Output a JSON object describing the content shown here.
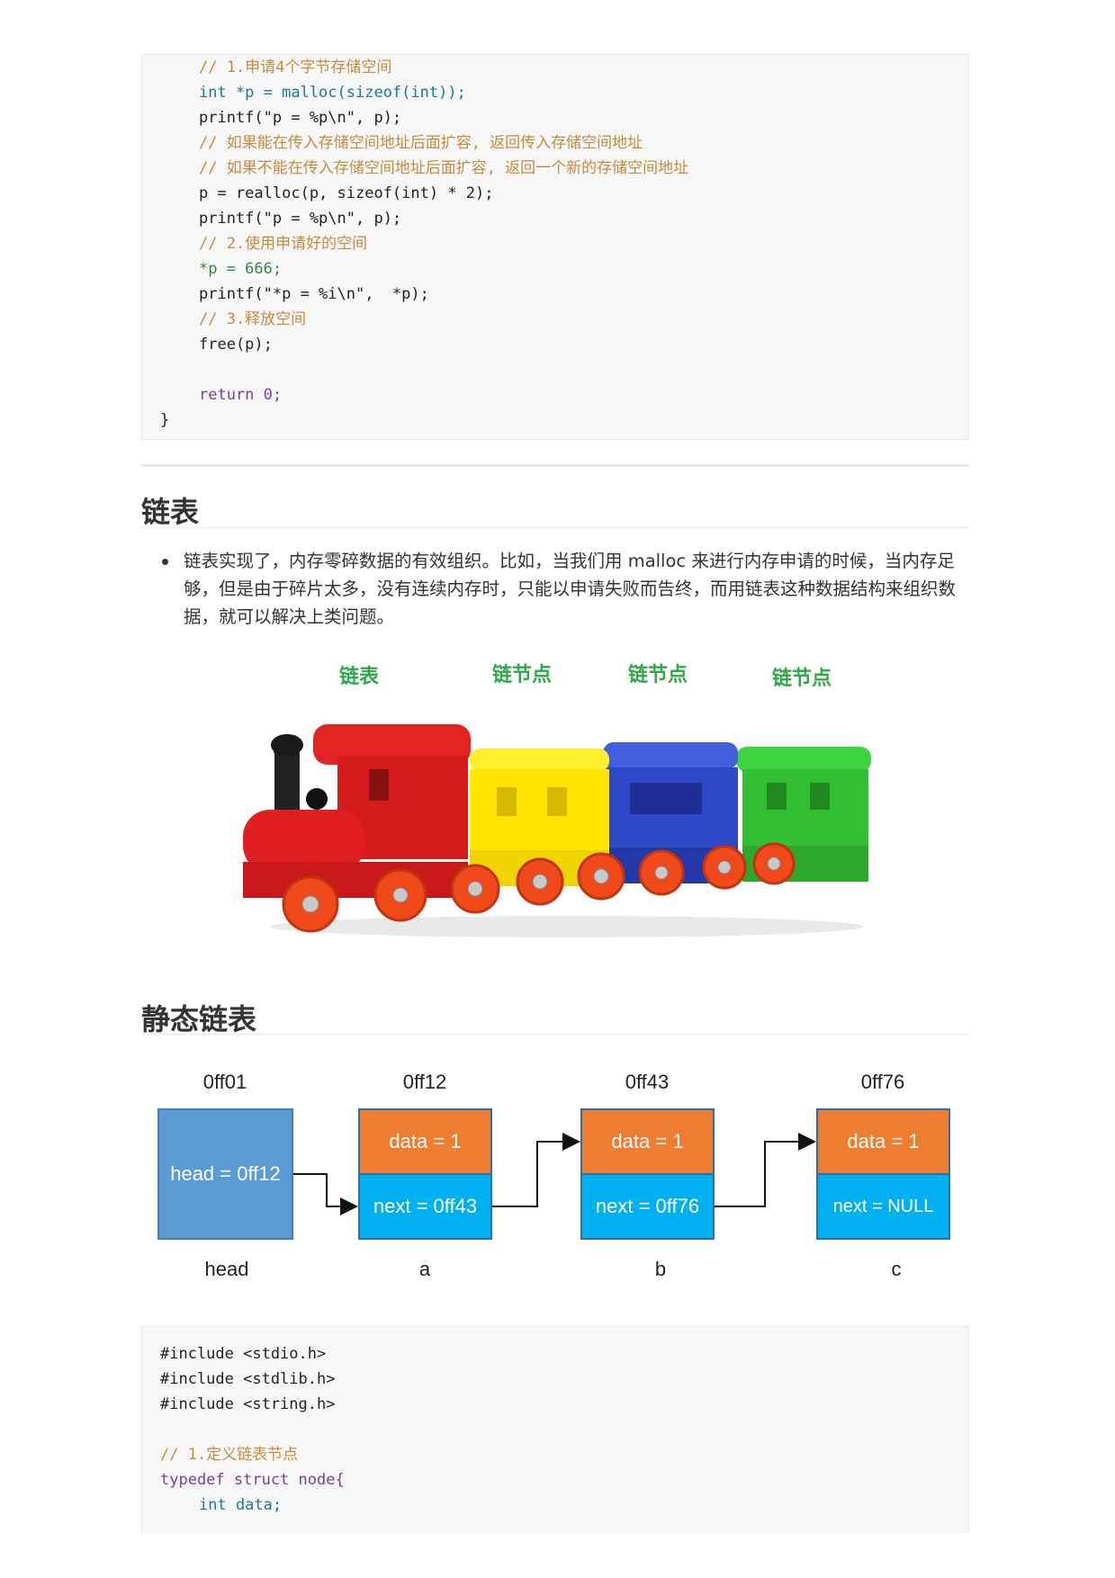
{
  "code1": {
    "lines": [
      "// 1.申请4个字节存储空间",
      "int *p = malloc(sizeof(int));",
      "printf(\"p = %p\\n\", p);",
      "// 如果能在传入存储空间地址后面扩容, 返回传入存储空间地址",
      "// 如果不能在传入存储空间地址后面扩容, 返回一个新的存储空间地址",
      "p = realloc(p, sizeof(int) * 2);",
      "printf(\"p = %p\\n\", p);",
      "// 2.使用申请好的空间",
      "*p = 666;",
      "printf(\"*p = %i\\n\",  *p);",
      "// 3.释放空间",
      "free(p);",
      "",
      "return 0;",
      "}"
    ]
  },
  "section1": {
    "title": "链表",
    "bullet": "链表实现了，内存零碎数据的有效组织。比如，当我们用 malloc 来进行内存申请的时候，当内存足够，但是由于碎片太多，没有连续内存时，只能以申请失败而告终，而用链表这种数据结构来组织数据，就可以解决上类问题。"
  },
  "toy": {
    "labels": [
      "链表",
      "链节点",
      "链节点",
      "链节点"
    ]
  },
  "section2": {
    "title": "静态链表"
  },
  "diagram": {
    "addresses": [
      "0ff01",
      "0ff12",
      "0ff43",
      "0ff76"
    ],
    "head_box": "head = 0ff12",
    "nodes": [
      {
        "data": "data = 1",
        "next": "next = 0ff43"
      },
      {
        "data": "data = 1",
        "next": "next = 0ff76"
      },
      {
        "data": "data = 1",
        "next": "next = NULL"
      }
    ],
    "names": [
      "head",
      "a",
      "b",
      "c"
    ]
  },
  "code2": {
    "lines": [
      "#include <stdio.h>",
      "#include <stdlib.h>",
      "#include <string.h>",
      "",
      "// 1.定义链表节点",
      "typedef struct node{",
      "int data;"
    ]
  }
}
